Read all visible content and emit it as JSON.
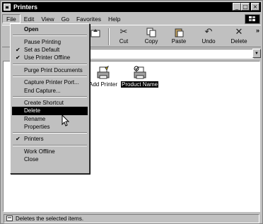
{
  "window": {
    "title": "Printers"
  },
  "menubar": {
    "items": [
      "File",
      "Edit",
      "View",
      "Go",
      "Favorites",
      "Help"
    ]
  },
  "toolbar": {
    "buttons": [
      {
        "label": "Cut",
        "icon": "cut-icon"
      },
      {
        "label": "Copy",
        "icon": "copy-icon"
      },
      {
        "label": "Paste",
        "icon": "paste-icon"
      },
      {
        "label": "Undo",
        "icon": "undo-icon"
      },
      {
        "label": "Delete",
        "icon": "delete-icon"
      }
    ],
    "more": "»"
  },
  "content": {
    "items": [
      {
        "label": "Add Printer",
        "icon": "add-printer-icon",
        "selected": false
      },
      {
        "label": "Product Name",
        "icon": "printer-icon",
        "selected": true
      }
    ]
  },
  "statusbar": {
    "text": "Deletes the selected items."
  },
  "file_menu": {
    "items": [
      {
        "label": "Open",
        "bold": true
      },
      {
        "sep": true
      },
      {
        "label": "Pause Printing"
      },
      {
        "label": "Set as Default",
        "checked": true
      },
      {
        "label": "Use Printer Offline",
        "checked": true
      },
      {
        "sep": true
      },
      {
        "label": "Purge Print Documents"
      },
      {
        "sep": true
      },
      {
        "label": "Capture Printer Port..."
      },
      {
        "label": "End Capture..."
      },
      {
        "sep": true
      },
      {
        "label": "Create Shortcut"
      },
      {
        "label": "Delete",
        "highlighted": true
      },
      {
        "label": "Rename"
      },
      {
        "label": "Properties"
      },
      {
        "sep": true
      },
      {
        "label": "Printers",
        "checked": true
      },
      {
        "sep": true
      },
      {
        "label": "Work Offline"
      },
      {
        "label": "Close"
      }
    ]
  }
}
